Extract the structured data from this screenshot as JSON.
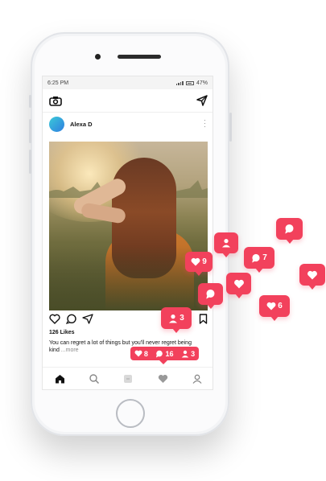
{
  "status": {
    "time": "6:25 PM",
    "battery": "47%"
  },
  "post": {
    "username": "Alexa D",
    "likes": "126 Likes",
    "caption": "You can regret a lot of things but you'll never regret being kind",
    "more": "...more"
  },
  "notification": {
    "likes": "8",
    "comments": "16",
    "followers": "3"
  },
  "floating": {
    "likes_a": "9",
    "comments_a": "7",
    "likes_b": "6",
    "followers_a": "3"
  },
  "colors": {
    "accent": "#f2415c"
  }
}
